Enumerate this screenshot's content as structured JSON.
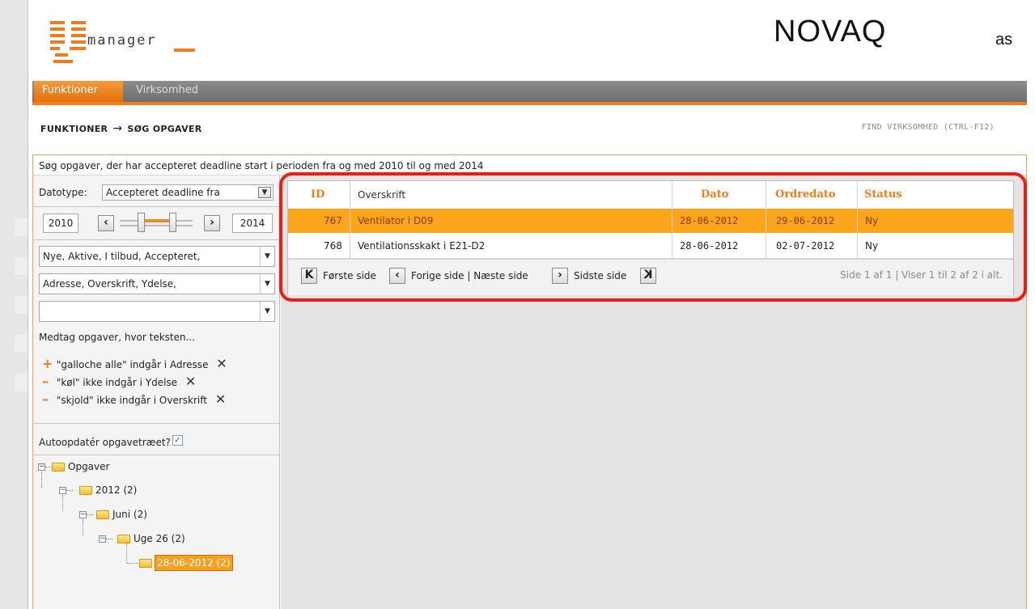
{
  "header": {
    "logo_word": "manager",
    "brand": "NOVAQ",
    "brand_suffix": "as"
  },
  "nav": {
    "tabs": [
      "Funktioner",
      "Virksomhed"
    ],
    "active_tab": "Funktioner"
  },
  "breadcrumb": {
    "parts": [
      "FUNKTIONER",
      "SØG OPGAVER"
    ],
    "arrow": "→",
    "find_link": "FIND VIRKSOMHED (CTRL-F12)"
  },
  "search": {
    "description": "Søg opgaver, der har accepteret deadline start i perioden fra og med 2010 til og med 2014",
    "datotype_label": "Datotype:",
    "datotype_value": "Accepteret deadline fra",
    "year_from": "2010",
    "year_to": "2014",
    "status_filter": "Nye, Aktive, I tilbud, Accepteret,",
    "field_filter": "Adresse, Overskrift, Ydelse,",
    "empty_filter": "",
    "include_label": "Medtag opgaver, hvor teksten...",
    "rules": [
      {
        "sign": "+",
        "text": "\"galloche alle\" indgår i Adresse"
      },
      {
        "sign": "–",
        "text": "\"køl\" ikke indgår i Ydelse"
      },
      {
        "sign": "–",
        "text": "\"skjold\" ikke indgår i Overskrift"
      }
    ],
    "remove_glyph": "✕",
    "autoupdate_label": "Autoopdatér opgavetræet?",
    "autoupdate_checked": true
  },
  "tree": {
    "nodes": [
      {
        "label": "Opgaver",
        "level": 0
      },
      {
        "label": "2012 (2)",
        "level": 1
      },
      {
        "label": "Juni (2)",
        "level": 2
      },
      {
        "label": "Uge 26 (2)",
        "level": 3
      },
      {
        "label": "28-06-2012 (2)",
        "level": 4,
        "selected": true
      }
    ]
  },
  "grid": {
    "columns": [
      "ID",
      "Overskrift",
      "Dato",
      "Ordredato",
      "Status"
    ],
    "rows": [
      {
        "id": "767",
        "title": "Ventilator i D09",
        "date": "28-06-2012",
        "order_date": "29-06-2012",
        "status": "Ny",
        "selected": true
      },
      {
        "id": "768",
        "title": "Ventilationsskakt i E21-D2",
        "date": "28-06-2012",
        "order_date": "02-07-2012",
        "status": "Ny",
        "selected": false
      }
    ],
    "pager": {
      "first": "Første side",
      "prev": "Forige side",
      "separator": "|",
      "next": "Næste side",
      "last": "Sidste side",
      "info": "Side 1 af 1 | Viser 1 til 2 af 2 i alt."
    }
  },
  "colors": {
    "accent": "#ee7d1e",
    "selected_row": "#fba51c",
    "highlight": "#ee1c12"
  }
}
